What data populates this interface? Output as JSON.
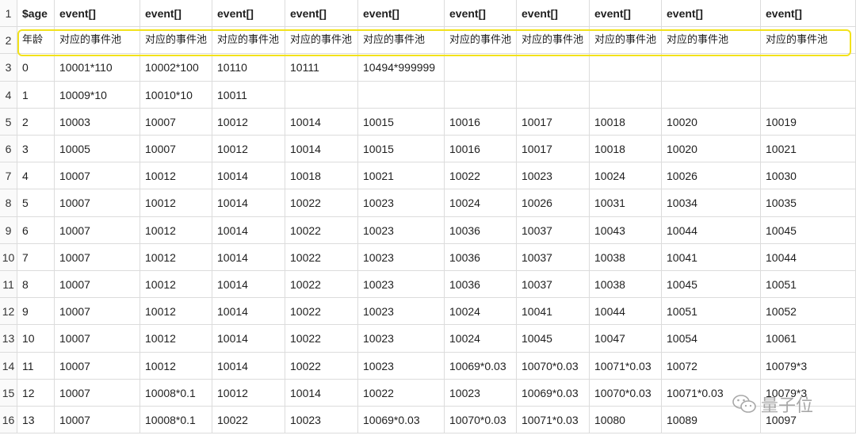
{
  "row_numbers": [
    "1",
    "2",
    "3",
    "4",
    "5",
    "6",
    "7",
    "8",
    "9",
    "10",
    "11",
    "12",
    "13",
    "14",
    "15",
    "16"
  ],
  "rows": [
    [
      "$age",
      "event[]",
      "event[]",
      "event[]",
      "event[]",
      "event[]",
      "event[]",
      "event[]",
      "event[]",
      "event[]",
      "event[]"
    ],
    [
      "年龄",
      "对应的事件池",
      "对应的事件池",
      "对应的事件池",
      "对应的事件池",
      "对应的事件池",
      "对应的事件池",
      "对应的事件池",
      "对应的事件池",
      "对应的事件池",
      "对应的事件池"
    ],
    [
      "0",
      "10001*110",
      "10002*100",
      "10110",
      "10111",
      "10494*999999",
      "",
      "",
      "",
      "",
      ""
    ],
    [
      "1",
      "10009*10",
      "10010*10",
      "10011",
      "",
      "",
      "",
      "",
      "",
      "",
      ""
    ],
    [
      "2",
      "10003",
      "10007",
      "10012",
      "10014",
      "10015",
      "10016",
      "10017",
      "10018",
      "10020",
      "10019"
    ],
    [
      "3",
      "10005",
      "10007",
      "10012",
      "10014",
      "10015",
      "10016",
      "10017",
      "10018",
      "10020",
      "10021"
    ],
    [
      "4",
      "10007",
      "10012",
      "10014",
      "10018",
      "10021",
      "10022",
      "10023",
      "10024",
      "10026",
      "10030"
    ],
    [
      "5",
      "10007",
      "10012",
      "10014",
      "10022",
      "10023",
      "10024",
      "10026",
      "10031",
      "10034",
      "10035"
    ],
    [
      "6",
      "10007",
      "10012",
      "10014",
      "10022",
      "10023",
      "10036",
      "10037",
      "10043",
      "10044",
      "10045"
    ],
    [
      "7",
      "10007",
      "10012",
      "10014",
      "10022",
      "10023",
      "10036",
      "10037",
      "10038",
      "10041",
      "10044"
    ],
    [
      "8",
      "10007",
      "10012",
      "10014",
      "10022",
      "10023",
      "10036",
      "10037",
      "10038",
      "10045",
      "10051"
    ],
    [
      "9",
      "10007",
      "10012",
      "10014",
      "10022",
      "10023",
      "10024",
      "10041",
      "10044",
      "10051",
      "10052"
    ],
    [
      "10",
      "10007",
      "10012",
      "10014",
      "10022",
      "10023",
      "10024",
      "10045",
      "10047",
      "10054",
      "10061"
    ],
    [
      "11",
      "10007",
      "10012",
      "10014",
      "10022",
      "10023",
      "10069*0.03",
      "10070*0.03",
      "10071*0.03",
      "10072",
      "10079*3"
    ],
    [
      "12",
      "10007",
      "10008*0.1",
      "10012",
      "10014",
      "10022",
      "10023",
      "10069*0.03",
      "10070*0.03",
      "10071*0.03",
      "10079*3"
    ],
    [
      "13",
      "10007",
      "10008*0.1",
      "10022",
      "10023",
      "10069*0.03",
      "10070*0.03",
      "10071*0.03",
      "10080",
      "10089",
      "10097"
    ]
  ],
  "watermark": {
    "text": "量子位",
    "icon": "wechat-icon"
  }
}
